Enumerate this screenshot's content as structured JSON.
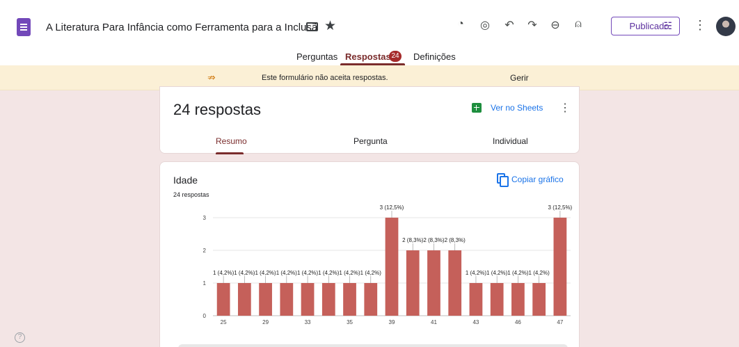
{
  "header": {
    "doc_title": "A Literatura Para  Infância como Ferramenta para a Inclusã",
    "publish_label": "Publicado",
    "icons": [
      "palette-icon",
      "preview-eye-icon",
      "undo-icon",
      "redo-icon",
      "link-icon",
      "add-collaborator-icon"
    ]
  },
  "tabs": [
    {
      "label": "Perguntas"
    },
    {
      "label": "Respostas",
      "badge": "24",
      "active": true
    },
    {
      "label": "Definições"
    }
  ],
  "banner": {
    "text": "Este formulário não aceita respostas.",
    "action": "Gerir",
    "color": "#fbf0d6"
  },
  "summary": {
    "count_text": "24 respostas",
    "sheets_label": "Ver no Sheets",
    "sub_tabs": [
      "Resumo",
      "Pergunta",
      "Individual"
    ],
    "active_sub_tab": "Resumo"
  },
  "question": {
    "title": "Idade",
    "responses": "24 respostas",
    "copy_label": "Copiar gráfico"
  },
  "colors": {
    "accent": "#7a2c2c",
    "bar": "#c5605a",
    "link": "#1a73e8",
    "form_purple": "#7248b9"
  },
  "chart_data": {
    "type": "bar",
    "categories": [
      "25",
      "",
      "29",
      "",
      "33",
      "",
      "35",
      "",
      "39",
      "",
      "41",
      "",
      "43",
      "",
      "46",
      "",
      "47"
    ],
    "values": [
      1,
      1,
      1,
      1,
      1,
      1,
      1,
      1,
      3,
      2,
      2,
      2,
      1,
      1,
      1,
      1,
      3
    ],
    "data_labels": [
      "1 (4,2%)",
      "1 (4,2%)",
      "1 (4,2%)",
      "1 (4,2%)",
      "1 (4,2%)",
      "1 (4,2%)",
      "1 (4,2%)",
      "1 (4,2%)",
      "3 (12,5%)",
      "2 (8,3%)",
      "2 (8,3%)",
      "2 (8,3%)",
      "1 (4,2%)",
      "1 (4,2%)",
      "1 (4,2%)",
      "1 (4,2%)",
      "3 (12,5%)"
    ],
    "y_ticks": [
      "0",
      "1",
      "2",
      "3"
    ],
    "ylim": [
      0,
      3
    ],
    "grid": true
  }
}
